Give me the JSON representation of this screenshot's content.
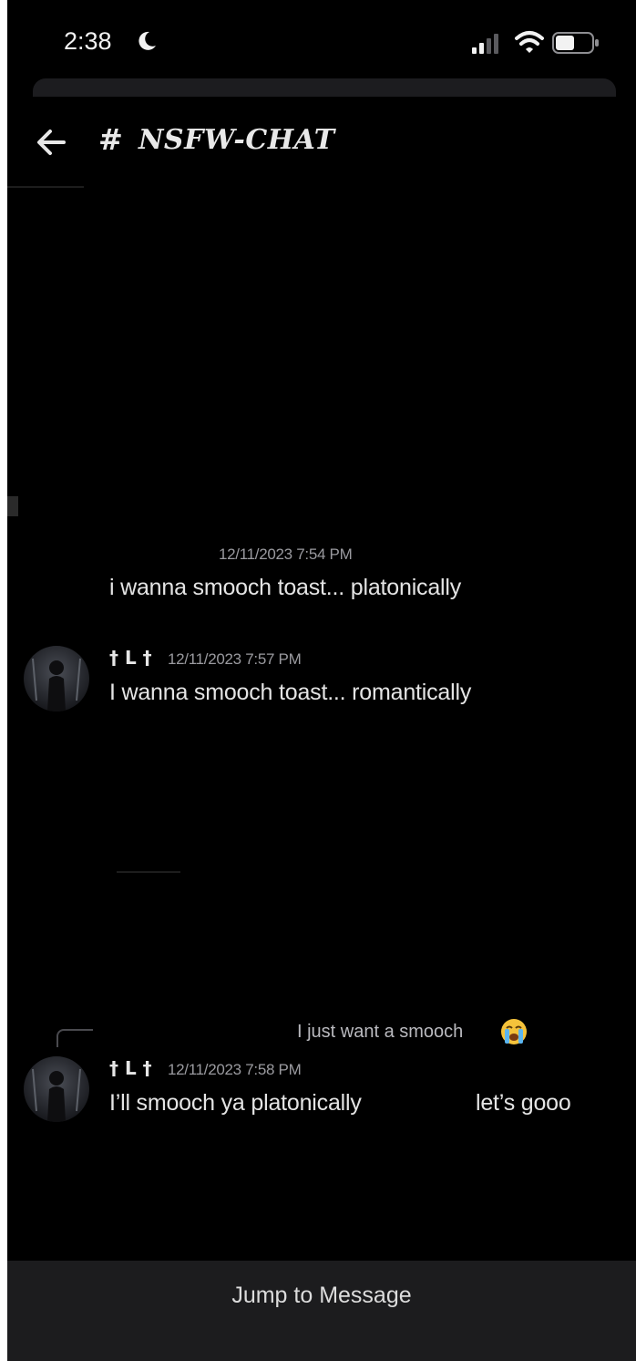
{
  "status_bar": {
    "time": "2:38",
    "icons": [
      "moon-icon",
      "signal-icon",
      "wifi-icon",
      "battery-icon"
    ]
  },
  "header": {
    "hash": "#",
    "channel_name": "NSFW-CHAT",
    "back_icon": "arrow-left-icon"
  },
  "messages": [
    {
      "timestamp": "12/11/2023 7:54 PM",
      "text": "i wanna smooch toast... platonically"
    },
    {
      "username": "† L †",
      "timestamp": "12/11/2023 7:57 PM",
      "text": "I wanna smooch toast... romantically"
    },
    {
      "reply_to": "I just want a smooch",
      "reply_emoji": "loudly-crying-face-icon",
      "username": "† L †",
      "timestamp": "12/11/2023 7:58 PM",
      "text_part1": "I’ll smooch ya platonically",
      "text_part2": "let’s gooo"
    }
  ],
  "footer": {
    "jump_label": "Jump to Message"
  },
  "colors": {
    "background": "#000000",
    "footer_bar": "#1c1c1e",
    "text": "#e4e4e4",
    "timestamp": "#9a9a9f"
  }
}
